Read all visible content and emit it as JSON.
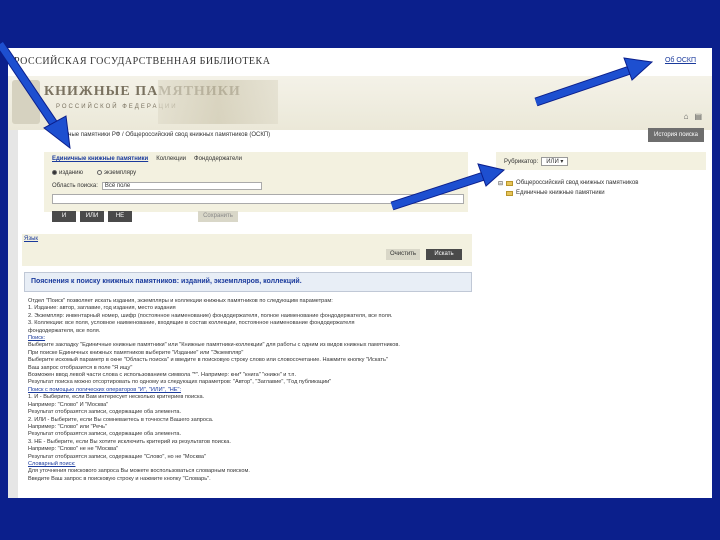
{
  "header": {
    "site_title": "РОССИЙСКАЯ ГОСУДАРСТВЕННАЯ БИБЛИОТЕКА",
    "top_link": "Об ОСКП",
    "logo_title": "КНИЖНЫЕ ПАМЯТНИКИ",
    "logo_sub": "РОССИЙСКОЙ ФЕДЕРАЦИИ"
  },
  "breadcrumb": "Книжные памятники РФ / Общероссийский свод книжных памятников (ОСКП)",
  "history_button": "История поиска",
  "search": {
    "tabs": [
      "Единичные книжные памятники",
      "Коллекции",
      "Фондодержатели"
    ],
    "radio_edition": "изданию",
    "radio_copy": "экземпляру",
    "area_label": "Область поиска:",
    "area_value": "Всё поле",
    "ops": [
      "И",
      "ИЛИ",
      "НЕ"
    ],
    "save_button": "Сохранить"
  },
  "rubricator": {
    "label": "Рубрикатор:",
    "value": "ИЛИ"
  },
  "tree": [
    "Общероссийский свод книжных памятников",
    "Единичные книжные памятники"
  ],
  "help_link": "Язык",
  "clear_button": "Очистить",
  "find_button": "Искать",
  "explain": {
    "title": "Пояснения к поиску книжных памятников: изданий, экземпляров, коллекций.",
    "lines": [
      "Отдел \"Поиск\" позволяет искать издания, экземпляры и коллекции книжных памятников по следующим параметрам:",
      "1. Издание: автор, заглавие, год издания, место издания",
      "2. Экземпляр: инвентарный номер, шифр (постоянное наименование) фондодержателя, полное наименование фондодержателя, все поля.",
      "3. Коллекции: все поля, условное наименование, входящие в состав коллекции, постоянное наименование фондодержателя",
      "фондодержателя, все поля.",
      "Поиск:",
      "Выберите закладку \"Единичные книжные памятники\" или \"Книжные памятники-коллекции\" для работы с одним из видов книжных памятников.",
      "При поиске Единичных книжных памятников выберите \"Издание\" или \"Экземпляр\"",
      "Выберите искомый параметр в окне \"Область поиска\" и введите в поисковую строку слово или словосочетание. Нажмите кнопку \"Искать\"",
      "Ваш запрос отобразится в поле \"Я ищу\"",
      "Возможен ввод левой части слова с использованием символа \"*\". Например: кни* \"книга\" \"книжн\" и т.п.",
      "Результат поиска можно отсортировать по одному из следующих параметров: \"Автор\", \"Заглавие\", \"Год публикации\"",
      "Поиск с помощью логических операторов \"И\", \"ИЛИ\", \"НЕ\":",
      "1. И - Выберите, если Вам интересует несколько критериев поиска.",
      "Например: \"Слово\" И \"Москва\"",
      "Результат отобразятся записи, содержащие оба элемента.",
      "2. ИЛИ - Выберите, если Вы сомневаетесь в точности Вашего запроса.",
      "Например: \"Слово\" или \"Речь\"",
      "Результат отобразятся записи, содержащие оба элемента.",
      "3. НЕ - Выберите, если Вы хотите исключить критерий из результатов поиска.",
      "Например: \"Слово\" не не \"Москва\"",
      "Результат отобразятся записи, содержащие \"Слово\", но не \"Москва\"",
      "Словарный поиск:",
      "Для уточнения поискового запроса Вы можете воспользоваться словарным поиском.",
      "Введите Ваш запрос в поисковую строку и нажмите кнопку \"Словарь\"."
    ]
  },
  "colors": {
    "frame": "#0b1f8c",
    "arrow": "#1d4fd0"
  }
}
